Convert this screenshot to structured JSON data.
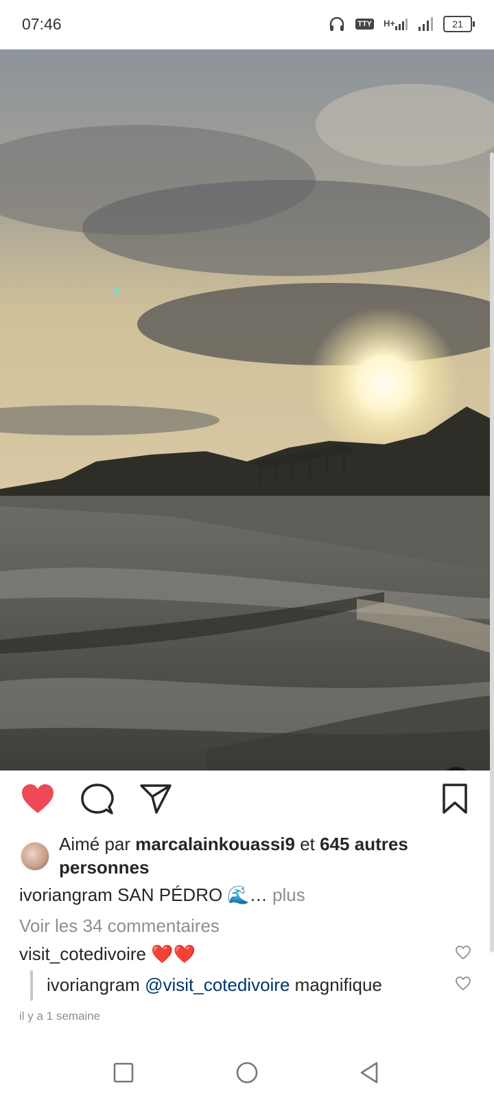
{
  "status_bar": {
    "time": "07:46",
    "tty": "TTY",
    "network": "H+",
    "battery": "21",
    "icons": [
      "headset-icon",
      "tty-icon",
      "signal-h-plus-icon",
      "signal-icon",
      "battery-icon"
    ]
  },
  "post": {
    "media": {
      "type": "video",
      "description_icon": "sunset-beach-video",
      "muted": true
    },
    "actions": {
      "icons": [
        "like-heart-filled-icon",
        "comment-icon",
        "share-send-icon",
        "bookmark-icon"
      ],
      "like_color": "#ed4956"
    },
    "likes": {
      "prefix": "Aimé par",
      "user": "marcalainkouassi9",
      "connector": "et",
      "others": "645 autres personnes"
    },
    "caption": {
      "user": "ivoriangram",
      "text": "SAN PÉDRO 🌊…",
      "more": "plus"
    },
    "view_comments": "Voir les 34 commentaires",
    "comments": [
      {
        "user": "visit_cotedivoire",
        "text": "❤️❤️"
      }
    ],
    "reply": {
      "user": "ivoriangram",
      "mention": "@visit_cotedivoire",
      "text": "magnifique"
    },
    "timestamp": "il y a 1 semaine"
  },
  "nav_bar": {
    "icons": [
      "recents-square-icon",
      "home-circle-icon",
      "back-triangle-icon"
    ]
  }
}
